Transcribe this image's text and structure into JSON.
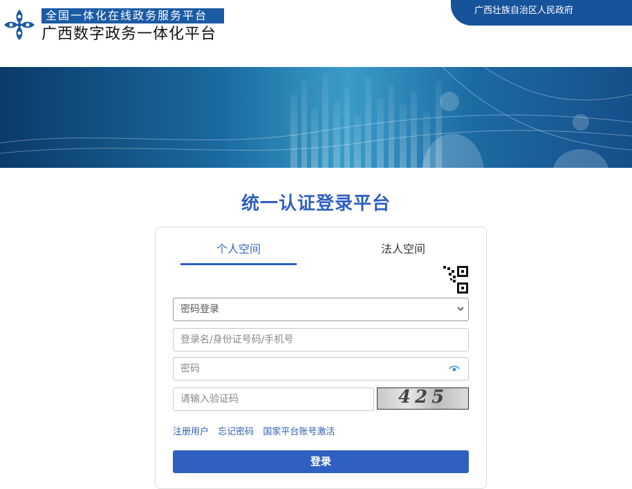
{
  "header": {
    "logo_top": "全国一体化在线政务服务平台",
    "logo_main": "广西数字政务一体化平台",
    "gov_link": "广西壮族自治区人民政府"
  },
  "page_title": "统一认证登录平台",
  "tabs": [
    {
      "label": "个人空间",
      "active": true
    },
    {
      "label": "法人空间",
      "active": false
    }
  ],
  "login_type": {
    "selected": "密码登录"
  },
  "fields": {
    "username_placeholder": "登录名/身份证号码/手机号",
    "password_placeholder": "密码",
    "captcha_placeholder": "请输入验证码",
    "captcha_text": "425"
  },
  "links": [
    "注册用户",
    "忘记密码",
    "国家平台账号激活"
  ],
  "login_button": "登录",
  "colors": {
    "accent": "#2f60c1",
    "header_blue": "#17539a",
    "logo_blue": "#1b5ba3"
  },
  "icons": [
    "logo-mark-icon",
    "qr-code-icon",
    "eye-icon",
    "chevron-down-icon"
  ]
}
